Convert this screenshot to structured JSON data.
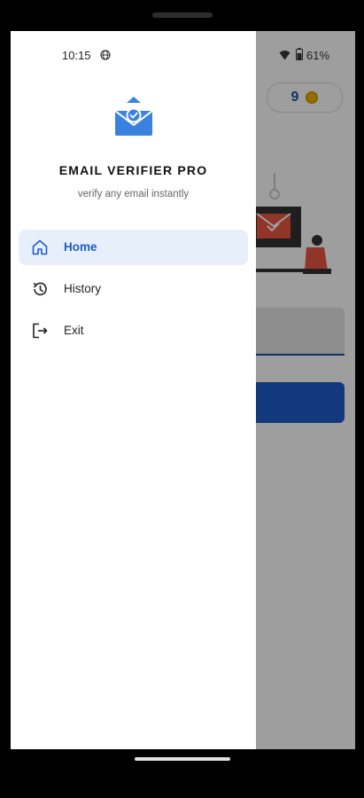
{
  "status_bar": {
    "time": "10:15",
    "battery": "61%"
  },
  "background_app": {
    "coin_count": "9"
  },
  "drawer": {
    "app_title": "EMAIL VERIFIER PRO",
    "app_subtitle": "verify any email instantly",
    "items": [
      {
        "label": "Home",
        "icon": "home-icon",
        "active": true
      },
      {
        "label": "History",
        "icon": "history-icon",
        "active": false
      },
      {
        "label": "Exit",
        "icon": "exit-icon",
        "active": false
      }
    ]
  },
  "colors": {
    "accent": "#1E5CC8",
    "active_bg": "#E7EFFB",
    "logo": "#3B82E0"
  }
}
